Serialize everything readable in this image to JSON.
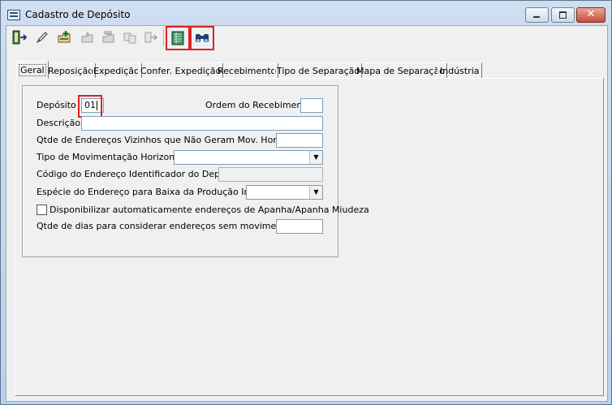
{
  "window": {
    "title": "Cadastro de Depósito",
    "controls": {
      "minimize": "—",
      "maximize": "□",
      "close": "✕"
    }
  },
  "toolbar": {
    "buttons": [
      {
        "name": "exit-button",
        "icon": "door-exit-icon",
        "glyph": "⇥",
        "enabled": true
      },
      {
        "name": "edit-button",
        "icon": "pencil-icon",
        "glyph": "✎",
        "enabled": true
      },
      {
        "name": "new-button",
        "icon": "folder-add-icon",
        "glyph": "✚",
        "enabled": true
      },
      {
        "name": "save-button",
        "icon": "disk-icon",
        "glyph": "⬒",
        "enabled": false
      },
      {
        "name": "cancel-button",
        "icon": "folder-cancel-icon",
        "glyph": "⬓",
        "enabled": false
      },
      {
        "name": "copy-button",
        "icon": "copy-icon",
        "glyph": "⧉",
        "enabled": false
      },
      {
        "name": "export-button",
        "icon": "arrow-export-icon",
        "glyph": "⇨",
        "enabled": false
      },
      {
        "name": "report-button",
        "icon": "sheet-icon",
        "glyph": "▦",
        "enabled": true
      },
      {
        "name": "search-button",
        "icon": "binoculars-icon",
        "glyph": "⚭",
        "enabled": true
      }
    ]
  },
  "tabs": [
    "Geral",
    "Reposição",
    "Expedição",
    "Confer. Expedição",
    "Recebimento",
    "Tipo de Separação",
    "Mapa de Separação",
    "Indústria"
  ],
  "form": {
    "deposito_label": "Depósito",
    "deposito_value": "01",
    "ordem_label": "Ordem do Recebimento",
    "ordem_value": "",
    "descricao_label": "Descrição",
    "descricao_value": "",
    "vizinhos_label": "Qtde de Endereços Vizinhos que Não Geram Mov. Horizontal",
    "vizinhos_value": "",
    "tipo_mov_label": "Tipo de Movimentação Horizontal",
    "tipo_mov_value": "",
    "codigo_label": "Código do Endereço Identificador do Depósito",
    "codigo_value": "",
    "especie_label": "Espécie do Endereço para Baixa da Produção Interna",
    "especie_value": "",
    "disponibilizar_label": "Disponibilizar automaticamente endereços de Apanha/Apanha Miudeza",
    "disponibilizar_checked": false,
    "dias_label": "Qtde de dias para considerar endereços sem movimentação",
    "dias_value": ""
  }
}
